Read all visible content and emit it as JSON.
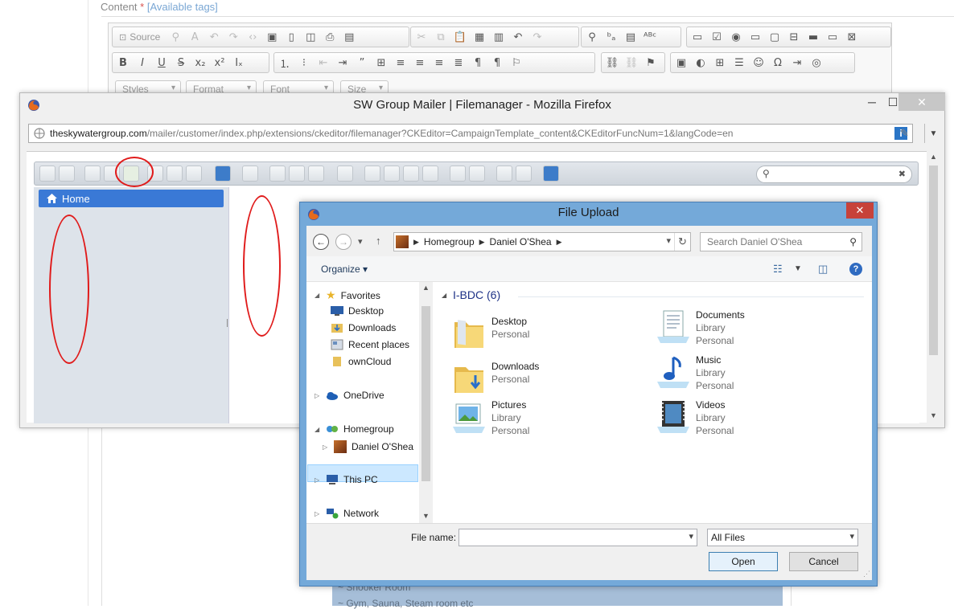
{
  "background": {
    "content_label": "Content",
    "required_mark": "*",
    "available_tags": "[Available tags]",
    "source_label": "Source",
    "combos": [
      "Styles",
      "Format",
      "Font",
      "Size"
    ],
    "bottom_items": [
      "~ Snooker Room",
      "~ Gym, Sauna, Steam room etc"
    ]
  },
  "firefox": {
    "title": "SW Group Mailer | Filemanager - Mozilla Firefox",
    "url_host": "theskywatergroup.com",
    "url_path": "/mailer/customer/index.php/extensions/ckeditor/filemanager?CKEditor=CampaignTemplate_content&CKEditorFuncNum=1&langCode=en",
    "info_icon": "i",
    "minimize": "─",
    "maximize": "☐",
    "close": "✕"
  },
  "filemanager": {
    "search_placeholder": "",
    "tree_root": "Home"
  },
  "dialog": {
    "title": "File Upload",
    "close": "✕",
    "breadcrumb": [
      "Homegroup",
      "Daniel O'Shea"
    ],
    "search_placeholder": "Search Daniel O'Shea",
    "organize_label": "Organize ▾",
    "nav": {
      "favorites": "Favorites",
      "favorites_children": [
        "Desktop",
        "Downloads",
        "Recent places",
        "ownCloud"
      ],
      "onedrive": "OneDrive",
      "homegroup": "Homegroup",
      "homegroup_user": "Daniel O'Shea",
      "this_pc": "This PC",
      "network": "Network"
    },
    "group_header": "I-BDC (6)",
    "items": [
      {
        "name": "Desktop",
        "sub1": "Personal",
        "sub2": "",
        "icon": "folder-icon"
      },
      {
        "name": "Documents",
        "sub1": "Library",
        "sub2": "Personal",
        "icon": "documents-library-icon"
      },
      {
        "name": "Downloads",
        "sub1": "Personal",
        "sub2": "",
        "icon": "folder-download-icon"
      },
      {
        "name": "Music",
        "sub1": "Library",
        "sub2": "Personal",
        "icon": "music-library-icon"
      },
      {
        "name": "Pictures",
        "sub1": "Library",
        "sub2": "Personal",
        "icon": "pictures-library-icon"
      },
      {
        "name": "Videos",
        "sub1": "Library",
        "sub2": "Personal",
        "icon": "videos-library-icon"
      }
    ],
    "file_name_label": "File name:",
    "file_name_value": "",
    "filter_value": "All Files",
    "open_label": "Open",
    "cancel_label": "Cancel"
  },
  "colors": {
    "accent": "#3a79d6",
    "annotation": "#e01b1b",
    "dialog_frame": "#74a9d9"
  }
}
